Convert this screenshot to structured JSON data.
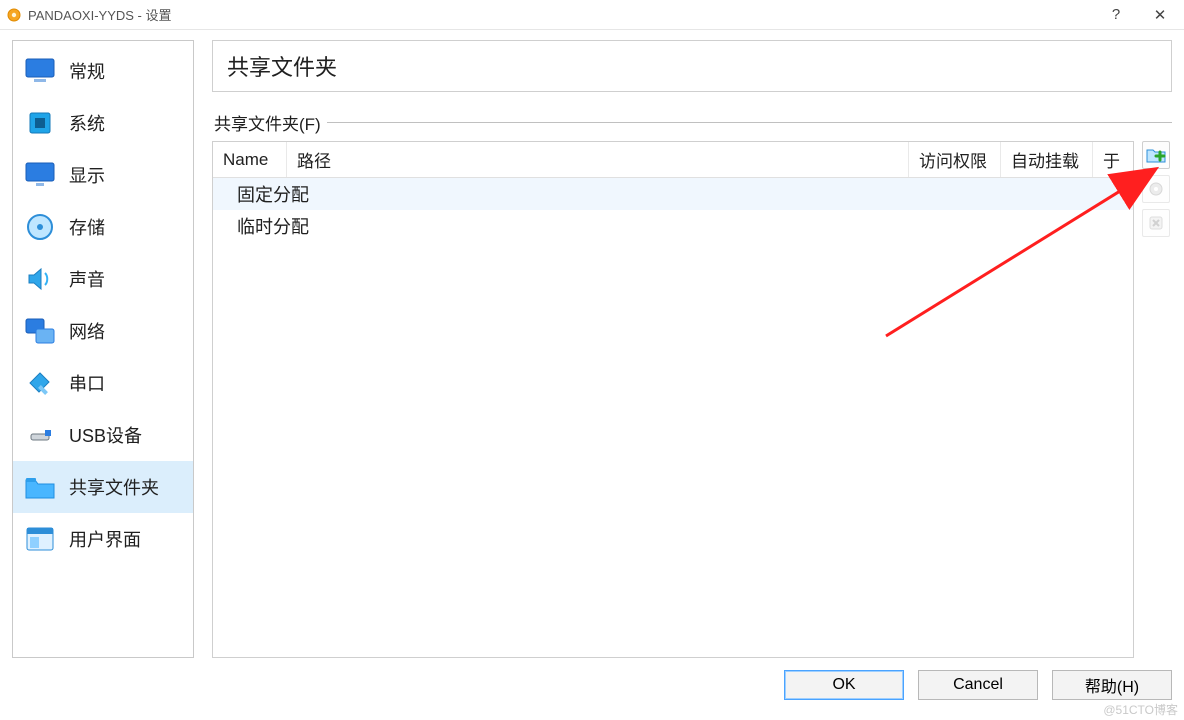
{
  "window": {
    "title": "PANDAOXI-YYDS - 设置",
    "help_symbol": "?",
    "close_symbol": "✕"
  },
  "sidebar": {
    "items": [
      {
        "label": "常规"
      },
      {
        "label": "系统"
      },
      {
        "label": "显示"
      },
      {
        "label": "存储"
      },
      {
        "label": "声音"
      },
      {
        "label": "网络"
      },
      {
        "label": "串口"
      },
      {
        "label": "USB设备"
      },
      {
        "label": "共享文件夹"
      },
      {
        "label": "用户界面"
      }
    ]
  },
  "panel": {
    "header": "共享文件夹",
    "legend": "共享文件夹(F)",
    "columns": {
      "name": "Name",
      "path": "路径",
      "access": "访问权限",
      "automount": "自动挂载",
      "at": "于"
    },
    "rows": {
      "fixed": "固定分配",
      "transient": "临时分配"
    }
  },
  "buttons": {
    "ok": "OK",
    "cancel": "Cancel",
    "help": "帮助(H)"
  },
  "watermark": "@51CTO博客"
}
